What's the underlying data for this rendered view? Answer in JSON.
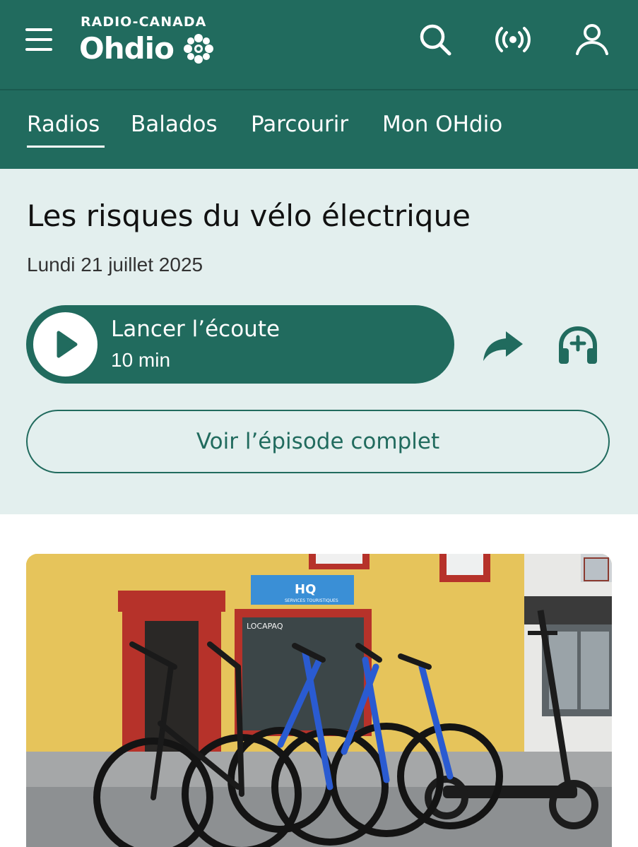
{
  "header": {
    "brand_top": "RADIO-CANADA",
    "brand_main": "Ohdio",
    "icons": [
      "menu-icon",
      "search-icon",
      "live-radio-icon",
      "user-icon"
    ]
  },
  "nav": {
    "tabs": [
      {
        "label": "Radios",
        "active": true
      },
      {
        "label": "Balados",
        "active": false
      },
      {
        "label": "Parcourir",
        "active": false
      },
      {
        "label": "Mon OHdio",
        "active": false
      }
    ]
  },
  "episode": {
    "title": "Les risques du vélo électrique",
    "date": "Lundi 21 juillet 2025",
    "play_label": "Lancer l’écoute",
    "duration": "10 min",
    "full_episode_label": "Voir l’épisode complet",
    "action_icons": [
      "share-icon",
      "add-to-list-icon"
    ]
  },
  "image": {
    "description_icon": "photo",
    "sign_text": "HQ",
    "sign_subtext": "SERVICES TOURISTIQUES",
    "shop_text": "LOCAPAQ"
  },
  "colors": {
    "brand_green": "#216b5e",
    "episode_bg": "#e3efee",
    "text_dark": "#111111"
  }
}
